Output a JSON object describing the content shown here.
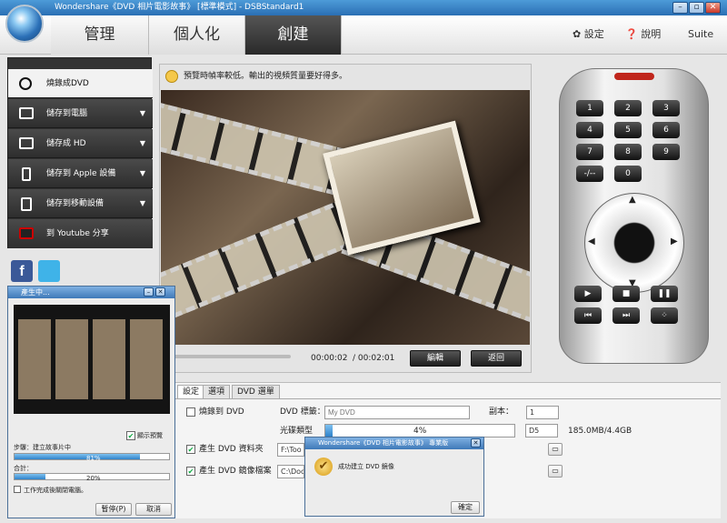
{
  "window": {
    "title": "Wondershare《DVD 相片電影故事》 [標準模式] - DSBStandard1"
  },
  "nav": {
    "tabs": [
      {
        "label": "管理"
      },
      {
        "label": "個人化"
      },
      {
        "label": "創建"
      }
    ],
    "active": 2
  },
  "header": {
    "settings": "設定",
    "help": "說明",
    "suite": "Suite"
  },
  "sidebar": {
    "items": [
      {
        "label": "燒錄成DVD"
      },
      {
        "label": "儲存到電腦"
      },
      {
        "label": "儲存成 HD"
      },
      {
        "label": "儲存到 Apple 設備"
      },
      {
        "label": "儲存到移動設備"
      },
      {
        "label": "到 Youtube 分享"
      }
    ]
  },
  "preview": {
    "notice": "預覽時幀率較低。輸出的視頻質量要好得多。",
    "time_current": "00:00:02",
    "time_total": "/ 00:02:01",
    "edit_btn": "編輯",
    "back_btn": "返回"
  },
  "remote": {
    "keys": [
      "1",
      "2",
      "3",
      "4",
      "5",
      "6",
      "7",
      "8",
      "9",
      "-/--",
      "0"
    ]
  },
  "settings": {
    "tabs": [
      "設定",
      "選項",
      "DVD 選單"
    ],
    "burn_dvd": "燒錄到 DVD",
    "dvd_label": "DVD 標籤：",
    "dvd_label_placeholder": "My DVD",
    "copies_label": "副本：",
    "copies_value": "1",
    "disc_type_label": "光碟類型",
    "disc_progress": "4%",
    "disc_type_value": "D5",
    "disc_size": "185.0MB/4.4GB",
    "gen_folder": "產生 DVD 資料夾",
    "folder_path": "F:\\Too",
    "gen_iso": "產生 DVD 鏡像檔案",
    "iso_path": "C:\\Doc"
  },
  "progress_dialog": {
    "title": "產生中...",
    "show_preview": "顯示預覽",
    "step_label": "步驟：建立故事片中",
    "step_percent": "81%",
    "step_value": 0.81,
    "total_label": "合計：",
    "total_percent": "20%",
    "total_value": 0.2,
    "shutdown": "工作完成後關閉電腦。",
    "pause_btn": "暫停(P)",
    "cancel_btn": "取消"
  },
  "done_dialog": {
    "title": "Wondershare《DVD 相片電影故事》 專業版",
    "message": "成功建立 DVD 鏡像",
    "ok_btn": "確定"
  },
  "colors": {
    "accent": "#3f79b8",
    "nav_active": "#2a2a2a",
    "progress": "#2f82c9"
  }
}
